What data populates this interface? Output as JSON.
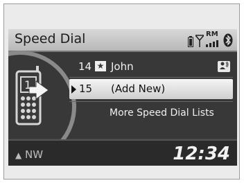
{
  "header": {
    "title": "Speed Dial",
    "roaming_label": "RM"
  },
  "list": {
    "items": [
      {
        "number": "14",
        "star_glyph": "★",
        "name": "John"
      },
      {
        "number": "15",
        "name": "(Add New)"
      },
      {
        "label": "More Speed Dial Lists"
      }
    ]
  },
  "phone_screen_digit": "1",
  "footer": {
    "compass_arrow": "▲",
    "compass": "NW",
    "clock": "12:34"
  },
  "colors": {
    "screen_bg": "#383838",
    "title_bar": "#c8c8c8",
    "selection": "#e6e6e6"
  }
}
